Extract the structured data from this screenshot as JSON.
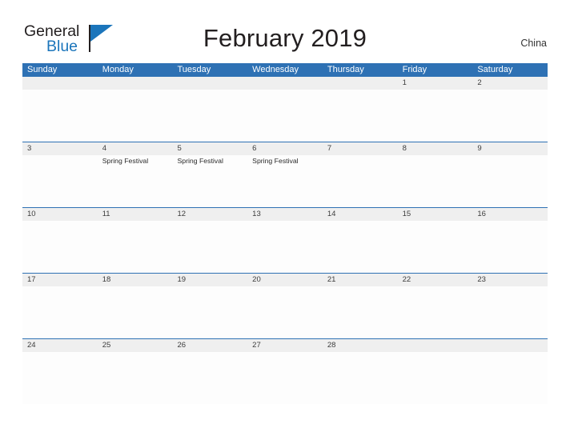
{
  "brand": {
    "word_one": "General",
    "word_two": "Blue",
    "flag_icon": "blue-triangle-flag-icon",
    "primary_color": "#1b75bb"
  },
  "header": {
    "title": "February 2019",
    "country": "China",
    "accent_color": "#2e71b4",
    "date_strip_color": "#efefef"
  },
  "calendar": {
    "weekdays": [
      "Sunday",
      "Monday",
      "Tuesday",
      "Wednesday",
      "Thursday",
      "Friday",
      "Saturday"
    ],
    "weeks": [
      [
        {
          "day": ""
        },
        {
          "day": ""
        },
        {
          "day": ""
        },
        {
          "day": ""
        },
        {
          "day": ""
        },
        {
          "day": "1",
          "events": []
        },
        {
          "day": "2",
          "events": []
        }
      ],
      [
        {
          "day": "3",
          "events": []
        },
        {
          "day": "4",
          "events": [
            "Spring Festival"
          ]
        },
        {
          "day": "5",
          "events": [
            "Spring Festival"
          ]
        },
        {
          "day": "6",
          "events": [
            "Spring Festival"
          ]
        },
        {
          "day": "7",
          "events": []
        },
        {
          "day": "8",
          "events": []
        },
        {
          "day": "9",
          "events": []
        }
      ],
      [
        {
          "day": "10",
          "events": []
        },
        {
          "day": "11",
          "events": []
        },
        {
          "day": "12",
          "events": []
        },
        {
          "day": "13",
          "events": []
        },
        {
          "day": "14",
          "events": []
        },
        {
          "day": "15",
          "events": []
        },
        {
          "day": "16",
          "events": []
        }
      ],
      [
        {
          "day": "17",
          "events": []
        },
        {
          "day": "18",
          "events": []
        },
        {
          "day": "19",
          "events": []
        },
        {
          "day": "20",
          "events": []
        },
        {
          "day": "21",
          "events": []
        },
        {
          "day": "22",
          "events": []
        },
        {
          "day": "23",
          "events": []
        }
      ],
      [
        {
          "day": "24",
          "events": []
        },
        {
          "day": "25",
          "events": []
        },
        {
          "day": "26",
          "events": []
        },
        {
          "day": "27",
          "events": []
        },
        {
          "day": "28",
          "events": []
        },
        {
          "day": ""
        },
        {
          "day": ""
        }
      ]
    ]
  }
}
